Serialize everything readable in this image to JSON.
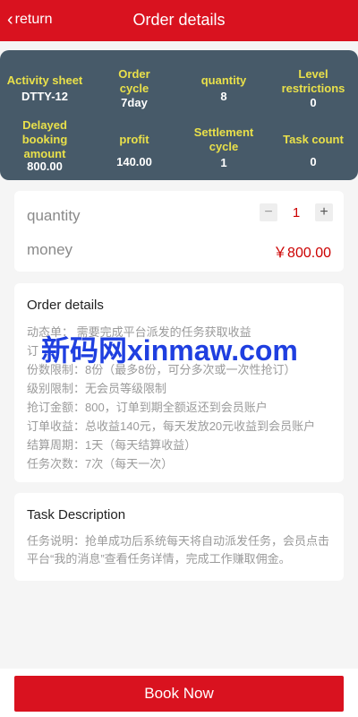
{
  "header": {
    "back_label": "return",
    "title": "Order details"
  },
  "stats": {
    "row1": [
      {
        "label": "Activity sheet",
        "value": "DTTY-12"
      },
      {
        "label": "Order cycle",
        "value": "7day"
      },
      {
        "label": "quantity",
        "value": "8"
      },
      {
        "label": "Level restrictions",
        "value": "0"
      }
    ],
    "row2": [
      {
        "label": "Delayed booking amount",
        "value": "800.00"
      },
      {
        "label": "profit",
        "value": "140.00"
      },
      {
        "label": "Settlement cycle",
        "value": "1"
      },
      {
        "label": "Task count",
        "value": "0"
      }
    ]
  },
  "order": {
    "quantity_label": "quantity",
    "quantity_value": "1",
    "minus": "−",
    "plus": "+",
    "money_label": "money",
    "money_value": "￥800.00"
  },
  "details": {
    "title": "Order details",
    "lines": [
      "动态单：    需要完成平台派发的任务获取收益",
      "订",
      "份数限制：8份（最多8份，可分多次或一次性抢订）",
      "级别限制：无会员等级限制",
      "抢订金额：800，订单到期全额返还到会员账户",
      "订单收益：总收益140元，每天发放20元收益到会员账户",
      "结算周期：1天（每天结算收益）",
      "任务次数：7次（每天一次）"
    ]
  },
  "watermark": "新码网xinmaw.com",
  "task": {
    "title": "Task Description",
    "text": "任务说明：抢单成功后系统每天将自动派发任务，会员点击平台“我的消息”查看任务详情，完成工作赚取佣金。"
  },
  "footer": {
    "book_label": "Book Now"
  },
  "colors": {
    "brand_red": "#d9121f",
    "stats_bg": "#475a69",
    "stats_label": "#e9e04a"
  }
}
